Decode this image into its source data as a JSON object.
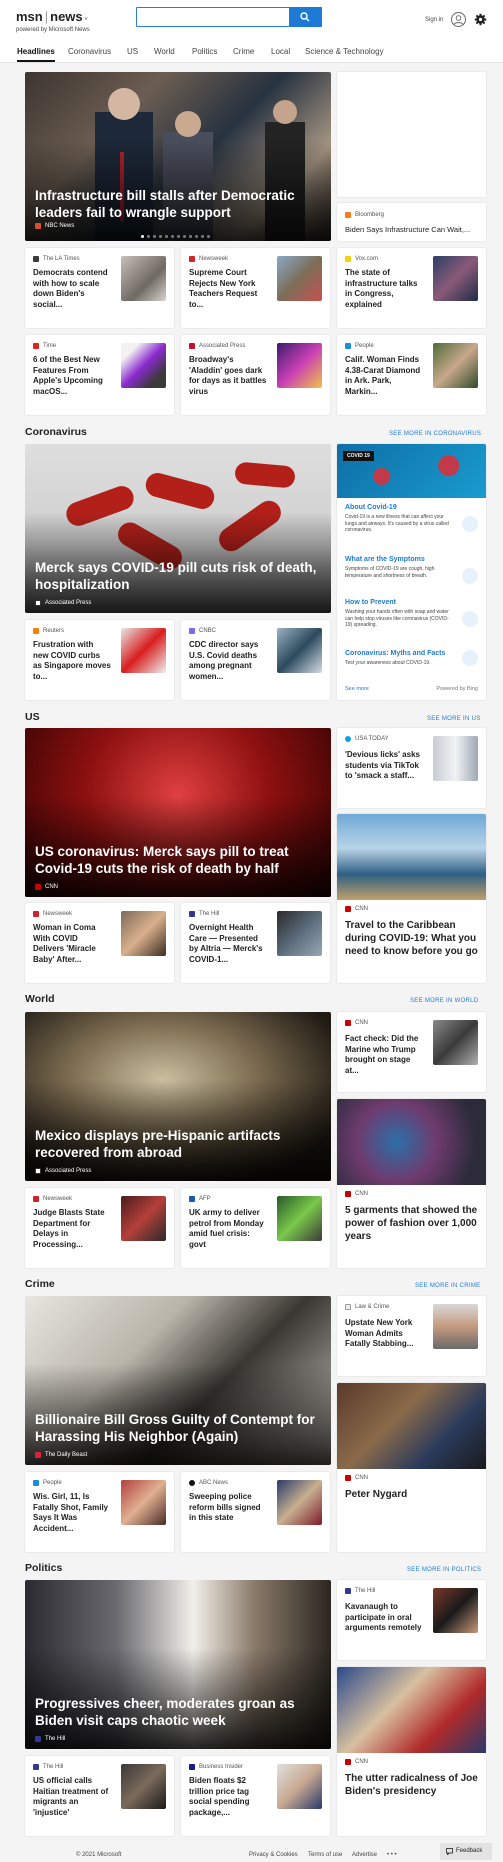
{
  "header": {
    "brand": "msn",
    "section": "news",
    "powered_by": "powered by Microsoft News",
    "search_placeholder": "",
    "signin": "Sign in"
  },
  "nav": {
    "tabs": [
      "Headlines",
      "Coronavirus",
      "US",
      "World",
      "Politics",
      "Crime",
      "Local",
      "Science & Technology"
    ]
  },
  "top": {
    "hero": {
      "title": "Infrastructure bill stalls after Democratic leaders fail to wrangle support",
      "source": "NBC News",
      "dots_total": 12,
      "dots_active": 1
    },
    "side": {
      "source": "Bloomberg",
      "title": "Biden Says Infrastructure Can Wait,..."
    },
    "row1": [
      {
        "source": "The LA Times",
        "title": "Democrats contend with how to scale down Biden's social..."
      },
      {
        "source": "Newsweek",
        "title": "Supreme Court Rejects New York Teachers Request to..."
      },
      {
        "source": "Vox.com",
        "title": "The state of infrastructure talks in Congress, explained"
      }
    ],
    "row2": [
      {
        "source": "Time",
        "title": "6 of the Best New Features From Apple's Upcoming macOS..."
      },
      {
        "source": "Associated Press",
        "title": "Broadway's 'Aladdin' goes dark for days as it battles virus"
      },
      {
        "source": "People",
        "title": "Calif. Woman Finds 4.38-Carat Diamond in Ark. Park, Markin..."
      }
    ]
  },
  "coronavirus": {
    "title": "Coronavirus",
    "more": "SEE MORE IN CORONAVIRUS",
    "hero": {
      "title": "Merck says COVID-19 pill cuts risk of death, hospitalization",
      "source": "Associated Press"
    },
    "panel": {
      "badge": "COVID 19",
      "items": [
        {
          "title": "About Covid-19",
          "desc": "Covid-19 is a new illness that can affect your lungs and airways. It's caused by a virus called coronavirus."
        },
        {
          "title": "What are the Symptoms",
          "desc": "Symptoms of COVID-19 are cough, high temperature and shortness of breath."
        },
        {
          "title": "How to Prevent",
          "desc": "Washing your hands often with soap and water can help stop viruses like coronavirus (COVID-19) spreading."
        },
        {
          "title": "Coronavirus: Myths and Facts",
          "desc": "Test your awareness about COVID-19."
        }
      ],
      "see_more": "See more",
      "powered": "Powered by Bing"
    },
    "cards": [
      {
        "source": "Reuters",
        "title": "Frustration with new COVID curbs as Singapore moves to..."
      },
      {
        "source": "CNBC",
        "title": "CDC director says U.S. Covid deaths among pregnant women..."
      }
    ]
  },
  "us": {
    "title": "US",
    "more": "SEE MORE IN US",
    "hero": {
      "title": "US coronavirus: Merck says pill to treat Covid-19 cuts the risk of death by half",
      "source": "CNN"
    },
    "side": {
      "source": "USA TODAY",
      "title": "'Devious licks' asks students via TikTok to 'smack a staff..."
    },
    "cards": [
      {
        "source": "Newsweek",
        "title": "Woman in Coma With COVID Delivers 'Miracle Baby' After..."
      },
      {
        "source": "The Hill",
        "title": "Overnight Health Care — Presented by Altria — Merck's COVID-1..."
      }
    ],
    "tile": {
      "source": "CNN",
      "title": "Travel to the Caribbean during COVID-19: What you need to know before you go"
    }
  },
  "world": {
    "title": "World",
    "more": "SEE MORE IN WORLD",
    "hero": {
      "title": "Mexico displays pre-Hispanic artifacts recovered from abroad",
      "source": "Associated Press"
    },
    "side": {
      "source": "CNN",
      "title": "Fact check: Did the Marine who Trump brought on stage at..."
    },
    "cards": [
      {
        "source": "Newsweek",
        "title": "Judge Blasts State Department for Delays in Processing..."
      },
      {
        "source": "AFP",
        "title": "UK army to deliver petrol from Monday amid fuel crisis: govt"
      }
    ],
    "tile": {
      "source": "CNN",
      "title": "5 garments that showed the power of fashion over 1,000 years"
    }
  },
  "crime": {
    "title": "Crime",
    "more": "SEE MORE IN CRIME",
    "hero": {
      "title": "Billionaire Bill Gross Guilty of Contempt for Harassing His Neighbor (Again)",
      "source": "The Daily Beast"
    },
    "side": {
      "source": "Law & Crime",
      "title": "Upstate New York Woman Admits Fatally Stabbing..."
    },
    "cards": [
      {
        "source": "People",
        "title": "Wis. Girl, 11, Is Fatally Shot, Family Says It Was Accident..."
      },
      {
        "source": "ABC News",
        "title": "Sweeping police reform bills signed in this state"
      }
    ],
    "tile": {
      "source": "CNN",
      "title": "Peter Nygard"
    }
  },
  "politics": {
    "title": "Politics",
    "more": "SEE MORE IN POLITICS",
    "hero": {
      "title": "Progressives cheer, moderates groan as Biden visit caps chaotic week",
      "source": "The Hill"
    },
    "side": {
      "source": "The Hill",
      "title": "Kavanaugh to participate in oral arguments remotely"
    },
    "cards": [
      {
        "source": "The Hill",
        "title": "US official calls Haitian treatment of migrants an 'injustice'"
      },
      {
        "source": "Business Insider",
        "title": "Biden floats $2 trillion price tag social spending package,..."
      }
    ],
    "tile": {
      "source": "CNN",
      "title": "The utter radicalness of Joe Biden's presidency"
    }
  },
  "footer": {
    "copyright": "© 2021 Microsoft",
    "privacy": "Privacy & Cookies",
    "terms": "Terms of use",
    "advertise": "Advertise",
    "more": "• • •",
    "feedback": "Feedback"
  },
  "colors": {
    "accent": "#1f7ad6",
    "cnn": "#cc0000"
  }
}
